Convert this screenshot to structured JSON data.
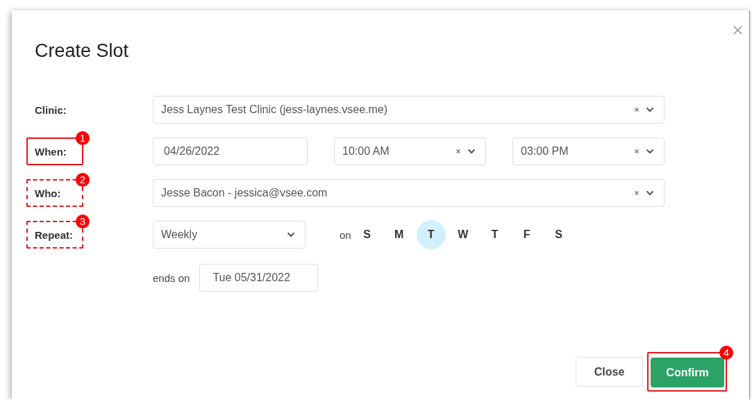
{
  "dialog": {
    "title": "Create Slot"
  },
  "rows": [
    {
      "label": "Clinic:",
      "fields": [
        {
          "kind": "select",
          "value": "Jess Laynes Test Clinic (jess-laynes.vsee.me)",
          "clearable": true
        }
      ]
    },
    {
      "label": "When:",
      "annotation": {
        "number": "1",
        "kind": "solid"
      },
      "fields": [
        {
          "kind": "input",
          "value": "04/26/2022"
        },
        {
          "kind": "select",
          "value": "10:00 AM",
          "clearable": true
        },
        {
          "kind": "select",
          "value": "03:00 PM",
          "clearable": true
        }
      ]
    },
    {
      "label": "Who:",
      "annotation": {
        "number": "2",
        "kind": "dashed"
      },
      "fields": [
        {
          "kind": "select",
          "value": "Jesse Bacon - jessica@vsee.com",
          "clearable": true
        }
      ]
    },
    {
      "label": "Repeat:",
      "annotation": {
        "number": "3",
        "kind": "dashed"
      },
      "fields": [
        {
          "kind": "select",
          "value": "Weekly",
          "clearable": false
        },
        {
          "kind": "days",
          "label": "on",
          "days": [
            {
              "label": "S",
              "selected": false
            },
            {
              "label": "M",
              "selected": false
            },
            {
              "label": "T",
              "selected": true
            },
            {
              "label": "W",
              "selected": false
            },
            {
              "label": "T",
              "selected": false
            },
            {
              "label": "F",
              "selected": false
            },
            {
              "label": "S",
              "selected": false
            }
          ]
        }
      ]
    }
  ],
  "ends": {
    "label": "ends on",
    "value": "Tue 05/31/2022"
  },
  "buttons": [
    {
      "label": "Close",
      "kind": "secondary"
    },
    {
      "label": "Confirm",
      "kind": "primary",
      "annotation": {
        "number": "4",
        "kind": "solid"
      }
    }
  ]
}
